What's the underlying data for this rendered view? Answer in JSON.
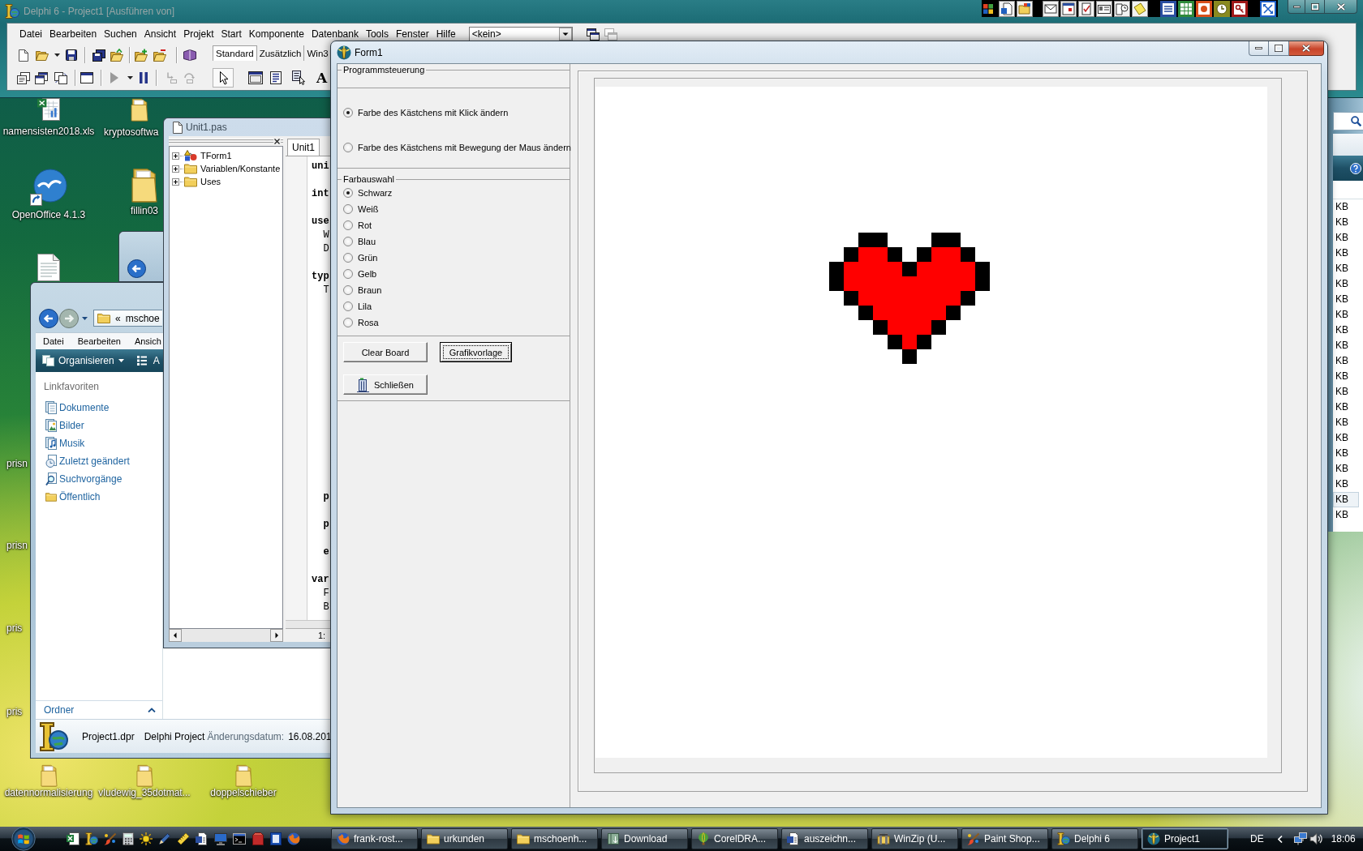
{
  "ide_window": {
    "title": "Delphi 6 - Project1 [Ausführen von]",
    "menu": [
      "Datei",
      "Bearbeiten",
      "Suchen",
      "Ansicht",
      "Projekt",
      "Start",
      "Komponente",
      "Datenbank",
      "Tools",
      "Fenster",
      "Hilfe"
    ],
    "component_selector": {
      "value": "<kein>"
    },
    "palette_tabs": [
      {
        "label": "Standard",
        "selected": true
      },
      {
        "label": "Zusätzlich",
        "selected": false
      },
      {
        "label": "Win3",
        "selected": false
      }
    ],
    "palette_glyph": "A"
  },
  "desktop_icons": [
    {
      "label": "namensisten2018.xls",
      "kind": "spreadsheet"
    },
    {
      "label": "kryptosoftwa",
      "kind": "folder"
    },
    {
      "label": "OpenOffice 4.1.3",
      "kind": "shortcut"
    },
    {
      "label": "fillin03",
      "kind": "folder"
    },
    {
      "label": "datennormalisierung",
      "kind": "folder"
    },
    {
      "label": "vludewig_35dotmat...",
      "kind": "folder"
    },
    {
      "label": "doppelschieber",
      "kind": "folder"
    }
  ],
  "desktop_cut_labels": [
    "prisn",
    "prisn",
    "pris",
    "pris"
  ],
  "explorer_window": {
    "address": {
      "overflow": "«",
      "path": "mschoe"
    },
    "menu": [
      "Datei",
      "Bearbeiten",
      "Ansich"
    ],
    "organize_button": "Organisieren",
    "views_button": "A",
    "favorites_heading": "Linkfavoriten",
    "favorites": [
      {
        "label": "Dokumente",
        "kind": "documents"
      },
      {
        "label": "Bilder",
        "kind": "pictures"
      },
      {
        "label": "Musik",
        "kind": "music"
      },
      {
        "label": "Zuletzt geändert",
        "kind": "recent"
      },
      {
        "label": "Suchvorgänge",
        "kind": "searches"
      },
      {
        "label": "Öffentlich",
        "kind": "public"
      }
    ],
    "folders_bar": {
      "label": "Ordner",
      "expanded": false
    },
    "details": {
      "name": "Project1.dpr",
      "type": "Delphi Project",
      "date_label": "Änderungsdatum:",
      "date": "16.08.201"
    }
  },
  "unit_window": {
    "title": "Unit1.pas",
    "tree": [
      {
        "label": "TForm1",
        "kind": "class",
        "expanded": false
      },
      {
        "label": "Variablen/Konstante",
        "kind": "folder",
        "expanded": false
      },
      {
        "label": "Uses",
        "kind": "folder",
        "expanded": false
      }
    ],
    "tab": "Unit1",
    "code_lines": [
      {
        "text": "uni",
        "kind": "keyword"
      },
      {
        "text": "int",
        "kind": "keyword"
      },
      {
        "text": "use",
        "kind": "keyword",
        "children": [
          {
            "text": "W",
            "kind": "identifier"
          },
          {
            "text": "D",
            "kind": "identifier"
          }
        ]
      },
      {
        "text": "typ",
        "kind": "keyword",
        "children": [
          {
            "text": "T",
            "kind": "identifier"
          },
          {
            "text": "p",
            "kind": "keyword"
          },
          {
            "text": "p",
            "kind": "keyword"
          },
          {
            "text": "e",
            "kind": "keyword"
          }
        ]
      },
      {
        "text": "var",
        "kind": "keyword",
        "children": [
          {
            "text": "F",
            "kind": "identifier"
          },
          {
            "text": "B",
            "kind": "identifier"
          }
        ]
      }
    ],
    "status": "1:"
  },
  "form_window": {
    "title": "Form1",
    "control_group_label": "Programmsteuerung",
    "mode_options": [
      {
        "label": "Farbe des Kästchens mit Klick ändern",
        "selected": true
      },
      {
        "label": "Farbe des Kästchens mit Bewegung der Maus ändern",
        "selected": false
      }
    ],
    "color_group": {
      "label": "Farbauswahl",
      "options": [
        {
          "label": "Schwarz",
          "selected": true
        },
        {
          "label": "Weiß",
          "selected": false
        },
        {
          "label": "Rot",
          "selected": false
        },
        {
          "label": "Blau",
          "selected": false
        },
        {
          "label": "Grün",
          "selected": false
        },
        {
          "label": "Gelb",
          "selected": false
        },
        {
          "label": "Braun",
          "selected": false
        },
        {
          "label": "Lila",
          "selected": false
        },
        {
          "label": "Rosa",
          "selected": false
        }
      ]
    },
    "buttons": [
      {
        "label": "Clear Board",
        "kind": "text",
        "focused": false
      },
      {
        "label": "Grafikvorlage",
        "kind": "text",
        "focused": true
      },
      {
        "label": "Schließen",
        "kind": "exit",
        "focused": false
      }
    ]
  },
  "file_list_window": {
    "size_cells": [
      {
        "text": "KB",
        "selected": false
      },
      {
        "text": "KB",
        "selected": false
      },
      {
        "text": "KB",
        "selected": false
      },
      {
        "text": "KB",
        "selected": false
      },
      {
        "text": "KB",
        "selected": false
      },
      {
        "text": "KB",
        "selected": false
      },
      {
        "text": "KB",
        "selected": false
      },
      {
        "text": "KB",
        "selected": false
      },
      {
        "text": "KB",
        "selected": false
      },
      {
        "text": "KB",
        "selected": false
      },
      {
        "text": "KB",
        "selected": false
      },
      {
        "text": "KB",
        "selected": false
      },
      {
        "text": "KB",
        "selected": false
      },
      {
        "text": "KB",
        "selected": false
      },
      {
        "text": "KB",
        "selected": false
      },
      {
        "text": "KB",
        "selected": false
      },
      {
        "text": "KB",
        "selected": false
      },
      {
        "text": "KB",
        "selected": false
      },
      {
        "text": "KB",
        "selected": false
      },
      {
        "text": "KB",
        "selected": true
      },
      {
        "text": "KB",
        "selected": false
      }
    ]
  },
  "taskbar": {
    "tasks": [
      {
        "label": "frank-rost...",
        "kind": "browser",
        "selected": false
      },
      {
        "label": "urkunden",
        "kind": "folder",
        "selected": false
      },
      {
        "label": "mschoenh...",
        "kind": "folder",
        "selected": false
      },
      {
        "label": "Download",
        "kind": "library",
        "selected": false
      },
      {
        "label": "CorelDRA...",
        "kind": "graphics",
        "selected": false
      },
      {
        "label": "auszeichn...",
        "kind": "document",
        "selected": false
      },
      {
        "label": "WinZip (U...",
        "kind": "archive",
        "selected": false
      },
      {
        "label": "Paint Shop...",
        "kind": "paint",
        "selected": false
      },
      {
        "label": "Delphi 6",
        "kind": "ide",
        "selected": false
      },
      {
        "label": "Project1",
        "kind": "app",
        "selected": true
      }
    ],
    "language": "DE",
    "clock": "18:06"
  }
}
